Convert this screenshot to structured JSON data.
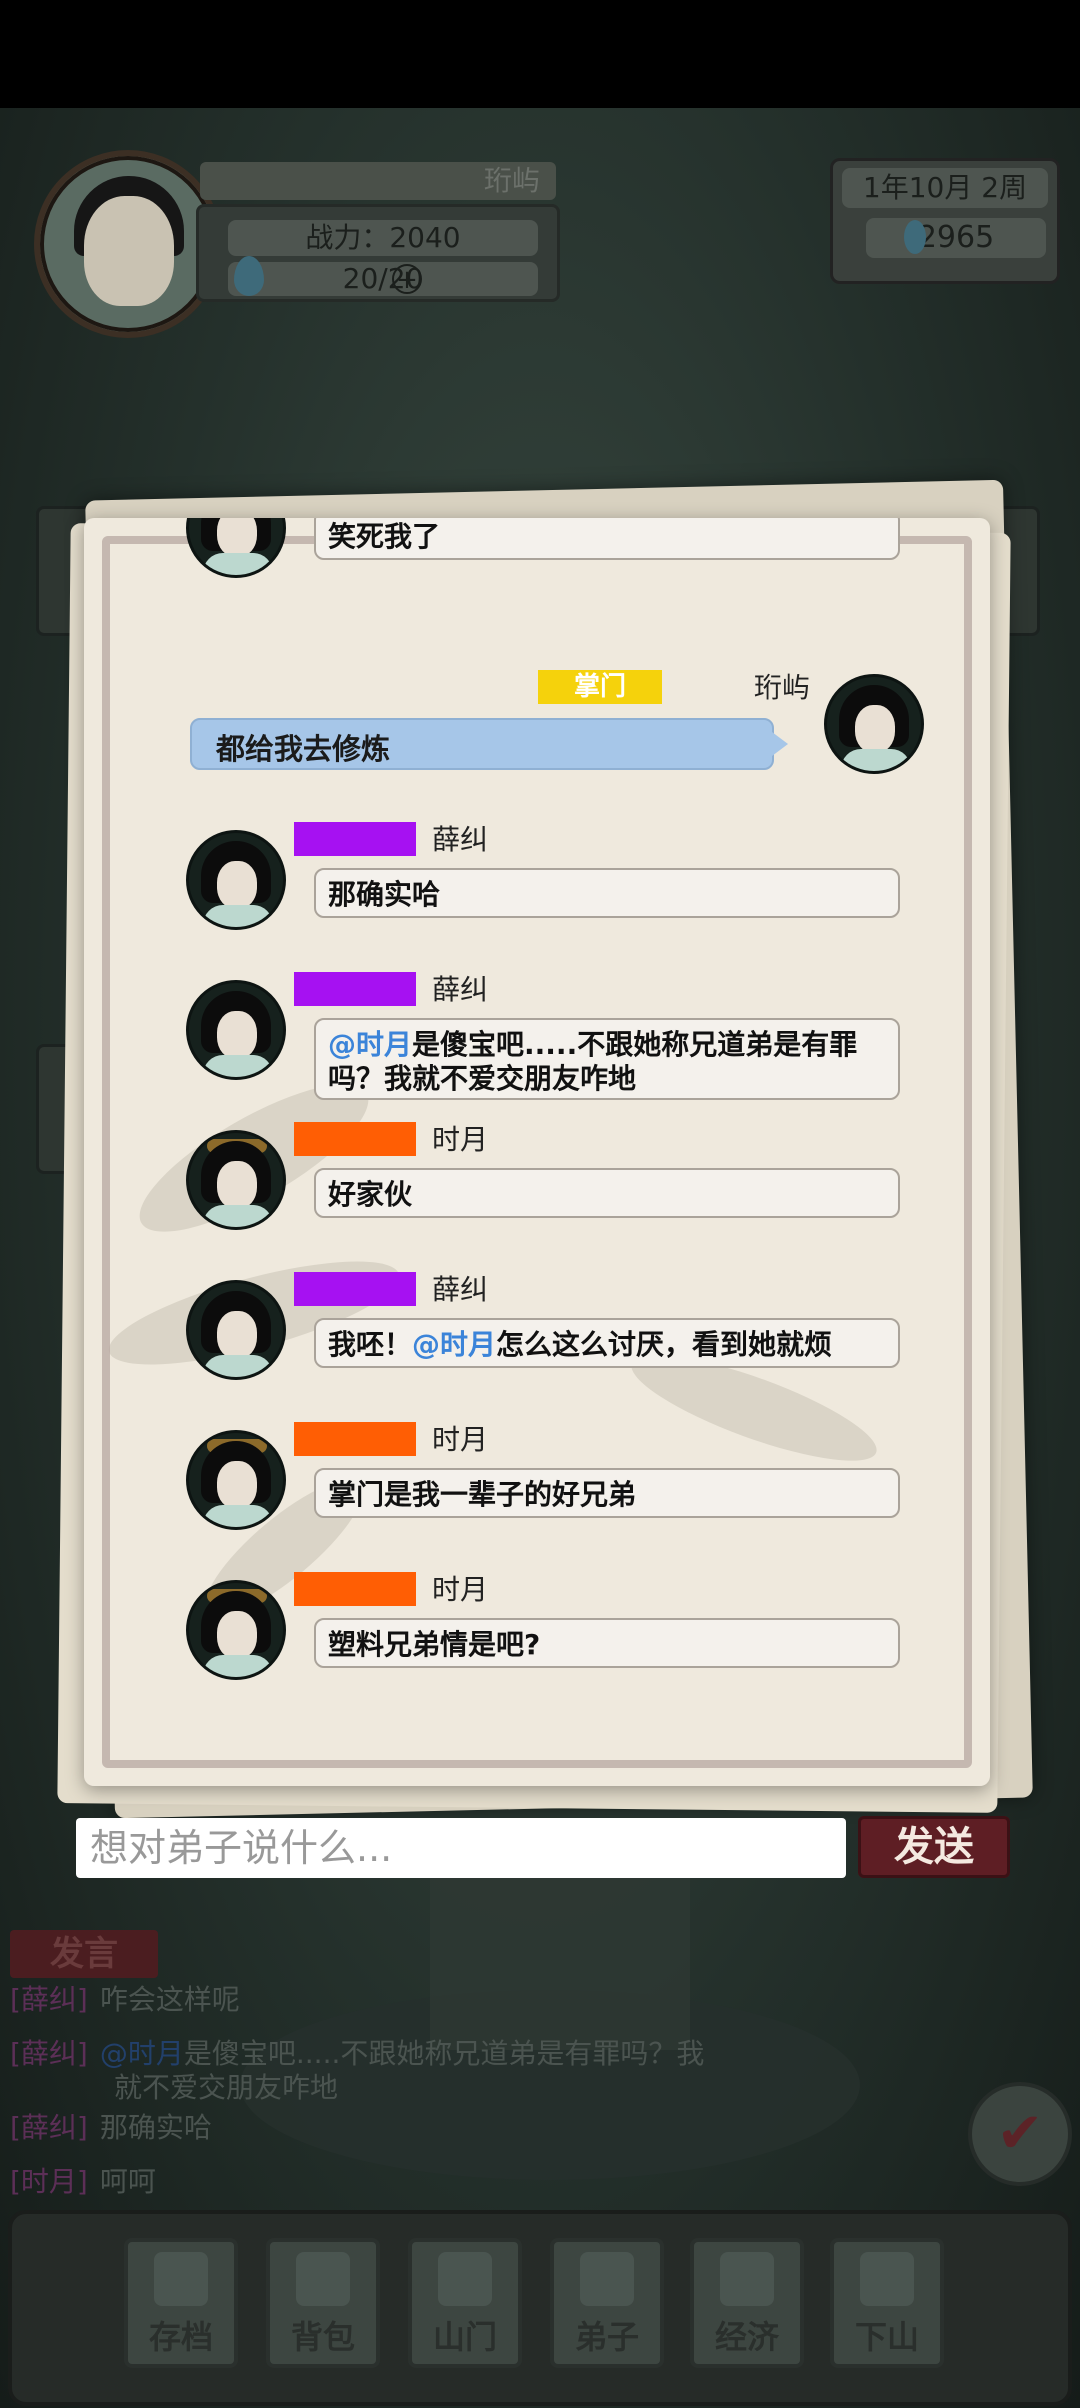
{
  "hud": {
    "player_name": "珩屿",
    "power": "战力：2040",
    "stamina": "20/20",
    "plus": "+",
    "date": "1年10月  2周",
    "money": "2965"
  },
  "chat": {
    "top_partial_text": "笑死我了",
    "messages": [
      {
        "sender": "珩屿",
        "role": "掌门",
        "role_color": "#f5d20c",
        "own": true,
        "text": "都给我去修炼"
      },
      {
        "sender": "薛纠",
        "role": "",
        "role_color": "#a611f2",
        "parts": [
          "那确实哈"
        ]
      },
      {
        "sender": "薛纠",
        "role": "",
        "role_color": "#a611f2",
        "mention": "@时月",
        "text_line1": "是傻宝吧.....不跟她称兄道弟是有罪",
        "text_line2": "吗？我就不爱交朋友咋地"
      },
      {
        "sender": "时月",
        "role": "",
        "role_color": "#ff5e04",
        "parts": [
          "好家伙"
        ]
      },
      {
        "sender": "薛纠",
        "role": "",
        "role_color": "#a611f2",
        "before": "我呸！",
        "mention": "@时月",
        "after": "怎么这么讨厌，看到她就烦"
      },
      {
        "sender": "时月",
        "role": "",
        "role_color": "#ff5e04",
        "parts": [
          "掌门是我一辈子的好兄弟"
        ]
      },
      {
        "sender": "时月",
        "role": "",
        "role_color": "#ff5e04",
        "parts": [
          "塑料兄弟情是吧?"
        ]
      }
    ]
  },
  "input": {
    "placeholder": "想对弟子说什么...",
    "send_label": "发送"
  },
  "feed": {
    "speak_tab": "发言",
    "lines": [
      {
        "tag": "[薛纠]",
        "text": "咋会这样呢"
      },
      {
        "tag": "[薛纠]",
        "mention": "@时月",
        "text": "是傻宝吧.....不跟她称兄道弟是有罪吗？我",
        "text2": "就不爱交朋友咋地"
      },
      {
        "tag": "[薛纠]",
        "text": "那确实哈"
      },
      {
        "tag": "[时月]",
        "text": "呵呵"
      }
    ]
  },
  "nav": {
    "items": [
      "存档",
      "背包",
      "山门",
      "弟子",
      "经济",
      "下山"
    ]
  }
}
